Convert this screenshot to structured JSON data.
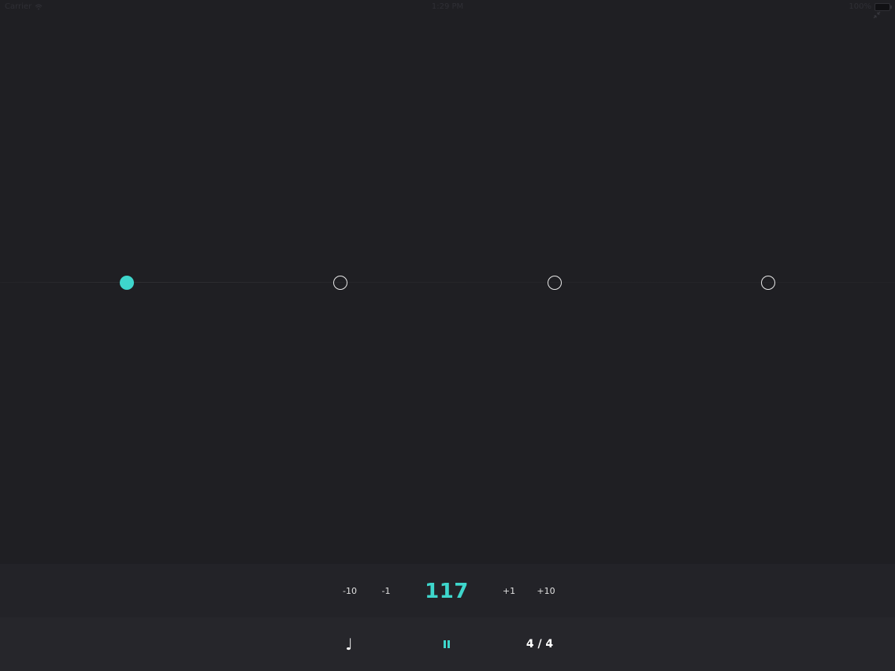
{
  "status_bar": {
    "carrier": "Carrier",
    "time": "1:29 PM",
    "battery": "100%"
  },
  "beats": {
    "count": 4,
    "active_index": 0,
    "accent_color": "#3ed6cc"
  },
  "tempo": {
    "minus_ten": "-10",
    "minus_one": "-1",
    "bpm": "117",
    "plus_one": "+1",
    "plus_ten": "+10"
  },
  "transport": {
    "note_icon": "♩",
    "state": "playing",
    "time_signature": "4 / 4"
  },
  "icons": {
    "wifi": "wifi-icon",
    "battery": "battery-icon",
    "fullscreen": "exit-fullscreen-icon",
    "note": "quarter-note-icon",
    "pause": "pause-icon"
  }
}
